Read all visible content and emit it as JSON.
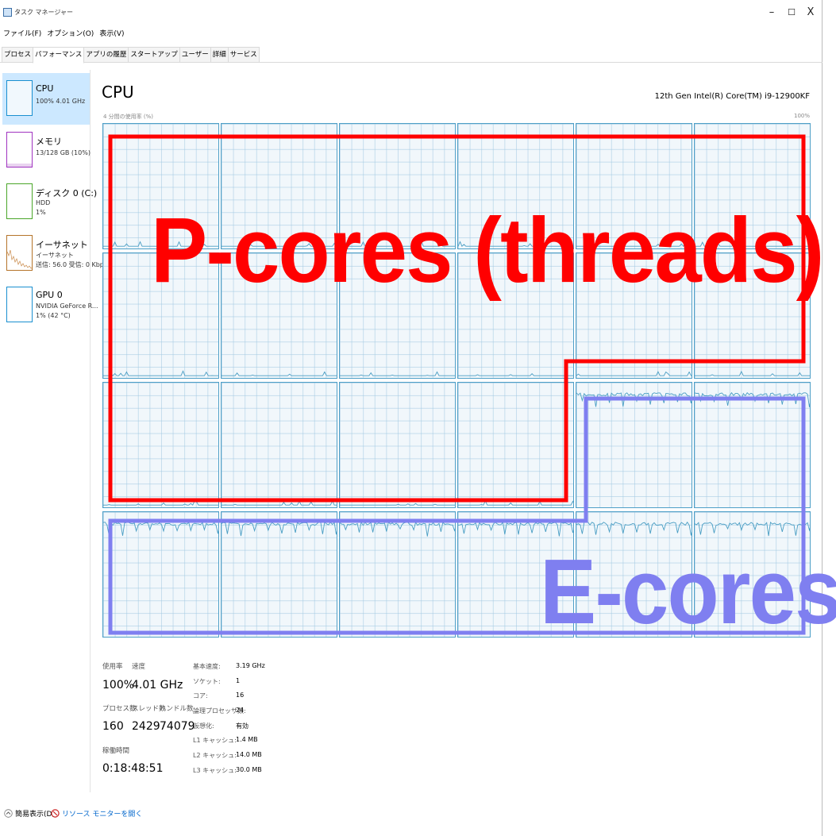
{
  "window": {
    "title": "タスク マネージャー",
    "minimize": "–",
    "maximize": "☐",
    "close": "X"
  },
  "menu": [
    "ファイル(F)",
    "オプション(O)",
    "表示(V)"
  ],
  "tabs": [
    "プロセス",
    "パフォーマンス",
    "アプリの履歴",
    "スタートアップ",
    "ユーザー",
    "詳細",
    "サービス"
  ],
  "active_tab": "パフォーマンス",
  "sidebar": {
    "items": [
      {
        "title": "CPU",
        "lines": [
          "100% 4.01 GHz"
        ],
        "color": "#1a8fd0"
      },
      {
        "title": "メモリ",
        "lines": [
          "13/128 GB (10%)"
        ],
        "color": "#a033c0"
      },
      {
        "title": "ディスク 0 (C:)",
        "lines": [
          "HDD",
          "1%"
        ],
        "color": "#4aa629"
      },
      {
        "title": "イーサネット",
        "lines": [
          "イーサネット",
          "送信: 56.0 受信: 0 Kbps"
        ],
        "color": "#b5742a"
      },
      {
        "title": "GPU 0",
        "lines": [
          "NVIDIA GeForce R...",
          "1% (42 °C)"
        ],
        "color": "#1a8fd0"
      }
    ]
  },
  "main": {
    "title": "CPU",
    "cpu_model": "12th Gen Intel(R) Core(TM) i9-12900KF",
    "graph_caption": "4 分間の使用率 (%)",
    "graph_max": "100%"
  },
  "graph": {
    "rows": 4,
    "cols": 6,
    "high_load_cells": [
      [
        2,
        4
      ],
      [
        2,
        5
      ],
      [
        3,
        0
      ],
      [
        3,
        1
      ],
      [
        3,
        2
      ],
      [
        3,
        3
      ],
      [
        3,
        4
      ],
      [
        3,
        5
      ]
    ],
    "high_load_level": 0.08,
    "idle_level": 0.97,
    "line_color": "#4a9ec4"
  },
  "annotations": {
    "p_cores_label": "P-cores (threads)",
    "p_cores_color": "#ff0000",
    "e_cores_label": "E-cores",
    "e_cores_color": "#7f7ff0"
  },
  "stats": {
    "usage_label": "使用率",
    "usage_value": "100%",
    "speed_label": "速度",
    "speed_value": "4.01 GHz",
    "processes_label": "プロセス数",
    "processes_value": "160",
    "threads_label": "スレッド数",
    "threads_value": "2429",
    "handles_label": "ハンドル数",
    "handles_value": "74079",
    "uptime_label": "稼働時間",
    "uptime_value": "0:18:48:51"
  },
  "specs": [
    {
      "label": "基本速度:",
      "value": "3.19 GHz"
    },
    {
      "label": "ソケット:",
      "value": "1"
    },
    {
      "label": "コア:",
      "value": "16"
    },
    {
      "label": "論理プロセッサ数:",
      "value": "24"
    },
    {
      "label": "仮想化:",
      "value": "有効"
    },
    {
      "label": "L1 キャッシュ:",
      "value": "1.4 MB"
    },
    {
      "label": "L2 キャッシュ:",
      "value": "14.0 MB"
    },
    {
      "label": "L3 キャッシュ:",
      "value": "30.0 MB"
    }
  ],
  "footer": {
    "less_details": "簡易表示(D)",
    "resource_monitor": "リソース モニターを開く"
  }
}
